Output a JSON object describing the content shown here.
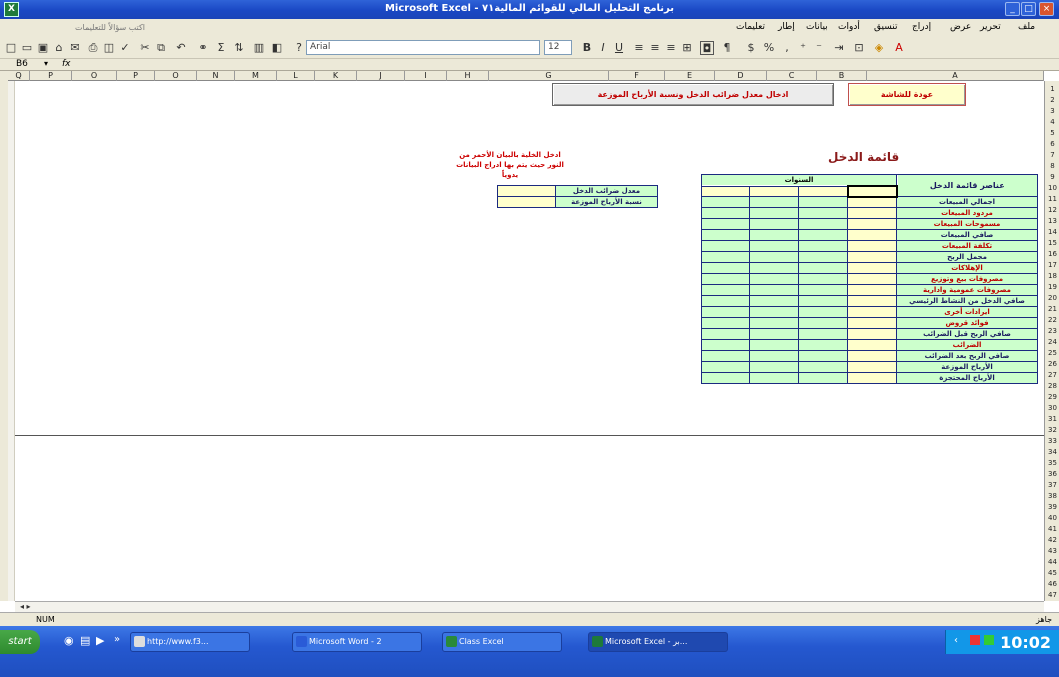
{
  "window": {
    "title": "Microsoft Excel - برنامج التحليل المالي للقوائم المالية٧١"
  },
  "menu": {
    "items": [
      "ملف",
      "تحرير",
      "عرض",
      "إدراج",
      "تنسيق",
      "أدوات",
      "بيانات",
      "إطار",
      "تعليمات"
    ],
    "help_placeholder": "اكتب سؤالاً للتعليمات"
  },
  "toolbar": {
    "font_name": "Arial",
    "font_size": "12"
  },
  "formula_bar": {
    "name_box": "B6",
    "fx_label": "fx"
  },
  "column_headers": [
    "Q",
    "P",
    "O",
    "P",
    "O",
    "N",
    "M",
    "L",
    "K",
    "J",
    "I",
    "H",
    "G",
    "F",
    "E",
    "D",
    "C",
    "B",
    "A"
  ],
  "row_headers": [
    "1",
    "2",
    "3",
    "4",
    "5",
    "6",
    "7",
    "8",
    "9",
    "10",
    "11",
    "12",
    "13",
    "14",
    "15",
    "16",
    "17",
    "18",
    "19",
    "20",
    "21",
    "22",
    "23",
    "24",
    "25",
    "26",
    "27",
    "28",
    "29",
    "30",
    "31",
    "32",
    "33",
    "34",
    "35",
    "36",
    "37",
    "38",
    "39",
    "40",
    "41",
    "42",
    "43",
    "44",
    "45",
    "46",
    "47"
  ],
  "sheet": {
    "home_button": "عودة للشاشة",
    "action_button": "ادخال معدل ضرائب الدخل ونسبة الأرباح الموزعة",
    "title": "قائمة الدخل",
    "note": "ادخل الخلية بالبيان الأحمر من النور حيث يتم بها ادراج البيانات يدوياً",
    "table_header_label": "عناصر قائمة الدخل",
    "table_header_years": "السنوات",
    "rows": [
      {
        "label": "اجمالي المبيعات",
        "color": "blk"
      },
      {
        "label": "مردود المبيعات",
        "color": "red"
      },
      {
        "label": "مسموحات المبيعات",
        "color": "red"
      },
      {
        "label": "صافي المبيعات",
        "color": "blk"
      },
      {
        "label": "تكلفة المبيعات",
        "color": "red"
      },
      {
        "label": "مجمل الربح",
        "color": "blk"
      },
      {
        "label": "الإهلاكات",
        "color": "red"
      },
      {
        "label": "مصروفات بيع وتوزيع",
        "color": "red"
      },
      {
        "label": "مصروفات عمومية وادارية",
        "color": "red"
      },
      {
        "label": "صافي الدخل من النشاط الرئيسي",
        "color": "blk"
      },
      {
        "label": "ايرادات أخرى",
        "color": "red"
      },
      {
        "label": "فوائد قروض",
        "color": "red"
      },
      {
        "label": "صافي الربح قبل الضرائب",
        "color": "blk"
      },
      {
        "label": "الضرائب",
        "color": "red"
      },
      {
        "label": "صافي الربح بعد الضرائب",
        "color": "blk"
      },
      {
        "label": "الأرباح الموزعة",
        "color": "blk"
      },
      {
        "label": "الأرباح المحتجزة",
        "color": "blk"
      }
    ],
    "side_rows": [
      "معدل ضرائب الدخل",
      "نسبة الأرباح الموزعة"
    ]
  },
  "status": {
    "left": "NUM",
    "right": "جاهز"
  },
  "taskbar": {
    "start": "start",
    "tasks": [
      {
        "label": "http://www.f3...",
        "active": false
      },
      {
        "label": "Microsoft Word - 2",
        "active": false
      },
      {
        "label": "Class Excel",
        "active": false
      },
      {
        "label": "Microsoft Excel - بر...",
        "active": true
      }
    ],
    "clock": "10:02"
  },
  "colors": {
    "header_green": "#ccffcc",
    "input_yellow": "#ffffcc",
    "border_navy": "#1b2a80",
    "label_red": "#c00000"
  }
}
